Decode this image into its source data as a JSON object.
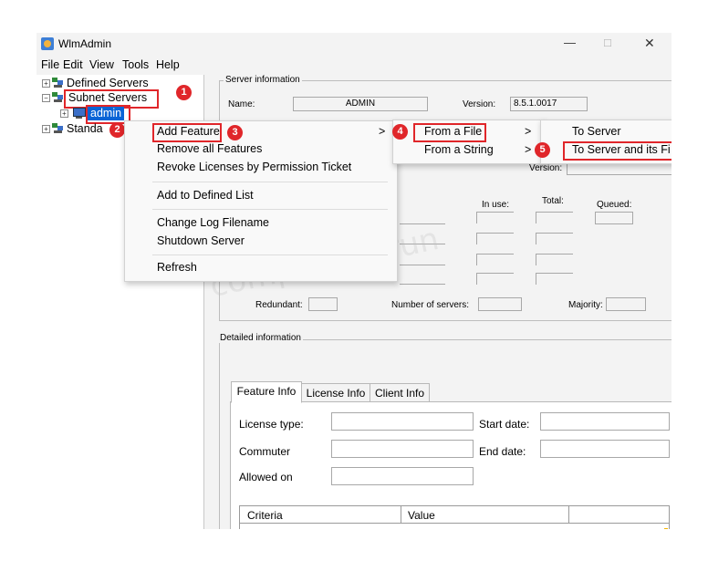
{
  "window": {
    "title": "WlmAdmin",
    "minimize_glyph": "—",
    "maximize_glyph": "□",
    "close_glyph": "✕"
  },
  "menubar": {
    "items": [
      "File",
      "Edit",
      "View",
      "Tools",
      "Help"
    ]
  },
  "tree": {
    "defined_servers": "Defined Servers",
    "subnet_servers": "Subnet Servers",
    "admin": "admin",
    "standalone_partial": "Standa"
  },
  "context_menu": {
    "items": [
      "Add Feature",
      "Remove all Features",
      "Revoke Licenses by Permission Ticket",
      "Add to Defined List",
      "Change Log Filename",
      "Shutdown Server",
      "Refresh"
    ],
    "submenu_arrow": ">"
  },
  "submenu_from": {
    "items": [
      "From a File",
      "From a String"
    ],
    "arrow": ">"
  },
  "submenu_to": {
    "items": [
      "To Server",
      "To Server and its Fi"
    ]
  },
  "badges": [
    "1",
    "2",
    "3",
    "4",
    "5"
  ],
  "server_info": {
    "group_title": "Server information",
    "name_label": "Name:",
    "name_value": "ADMIN",
    "version_label": "Version:",
    "version_value": "8.5.1.0017",
    "version2_label": "Version:",
    "inuse_label": "In use:",
    "total_label": "Total:",
    "queued_label": "Queued:",
    "redundant_label": "Redundant:",
    "numservers_label": "Number of servers:",
    "majority_label": "Majority:"
  },
  "detail": {
    "group_title": "Detailed information",
    "tabs": [
      "Feature Info",
      "License Info",
      "Client Info"
    ],
    "license_type_label": "License type:",
    "start_date_label": "Start date:",
    "commuter_label": "Commuter",
    "end_date_label": "End date:",
    "allowed_on_label": "Allowed on",
    "table_headers": [
      "Criteria",
      "Value"
    ]
  },
  "watermark": "compileandrun",
  "colors": {
    "accent_red": "#e0262a",
    "selection_blue": "#0a64d6"
  }
}
